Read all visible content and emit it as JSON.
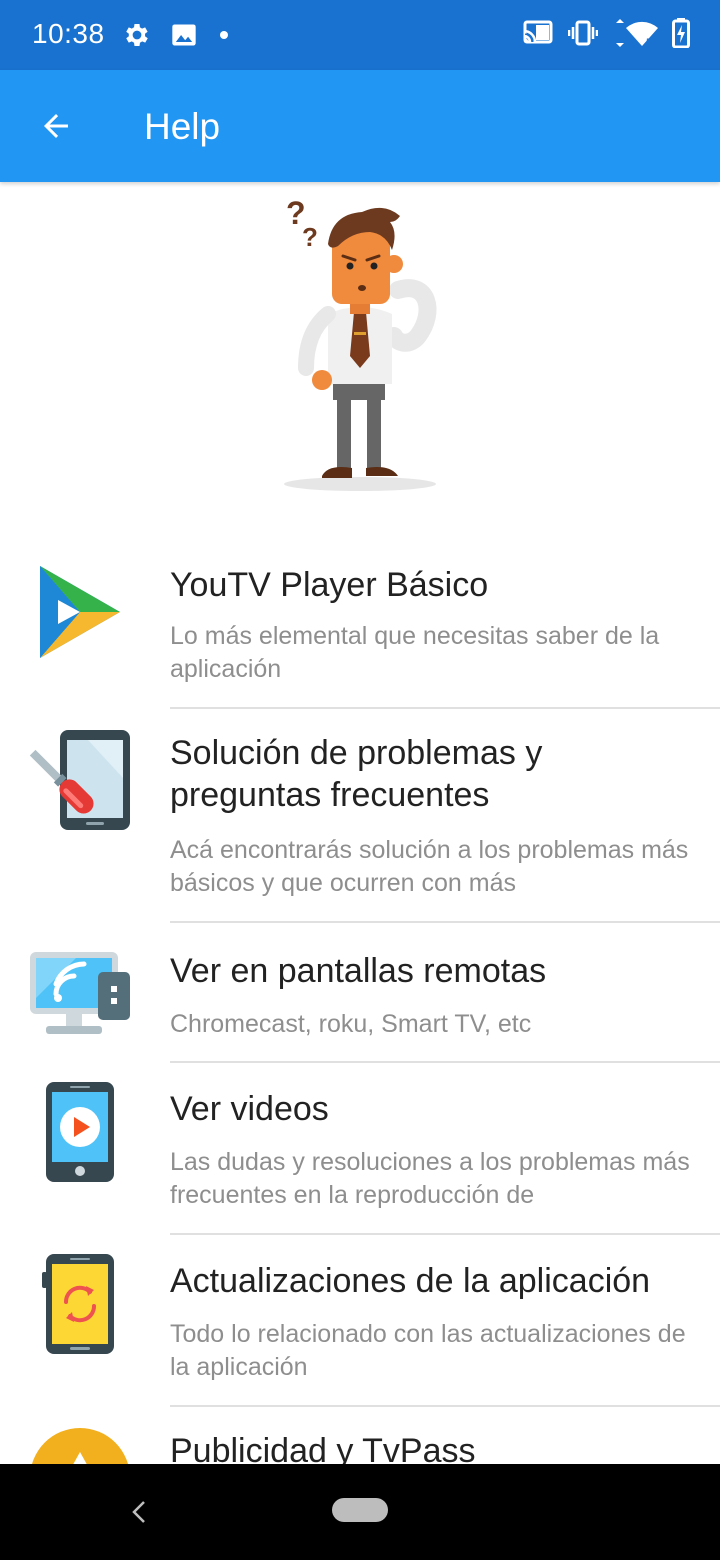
{
  "status_bar": {
    "time": "10:38",
    "left_icons": [
      "gear-icon",
      "image-icon",
      "dot-icon"
    ],
    "right_icons": [
      "cast-icon",
      "vibrate-icon",
      "wifi-icon",
      "battery-icon"
    ],
    "background": "#1a72d0"
  },
  "app_bar": {
    "title": "Help",
    "back_icon": "arrow-left-icon",
    "background": "#2196f3"
  },
  "hero": {
    "illustration": "confused-man-illustration"
  },
  "help_items": [
    {
      "title": "YouTV Player Básico",
      "description": "Lo más elemental que necesitas saber de la aplicación",
      "icon": "play-logo-icon"
    },
    {
      "title": "Solución de problemas y preguntas frecuentes",
      "description": "Acá encontrarás solución a los problemas más básicos y que ocurren con más",
      "icon": "tablet-screwdriver-icon"
    },
    {
      "title": "Ver en pantallas remotas",
      "description": "Chromecast, roku, Smart TV, etc",
      "icon": "monitor-cast-icon"
    },
    {
      "title": "Ver videos",
      "description": "Las dudas y resoluciones a los problemas más frecuentes en la reproducción de",
      "icon": "phone-video-icon"
    },
    {
      "title": "Actualizaciones de la aplicación",
      "description": "Todo lo relacionado con las actualizaciones de la aplicación",
      "icon": "phone-refresh-icon"
    },
    {
      "title": "Publicidad y TvPass",
      "description": "",
      "icon": "warning-circle-icon"
    }
  ],
  "nav_bar": {
    "back_icon": "chevron-left-icon",
    "home_icon": "home-pill-icon"
  }
}
